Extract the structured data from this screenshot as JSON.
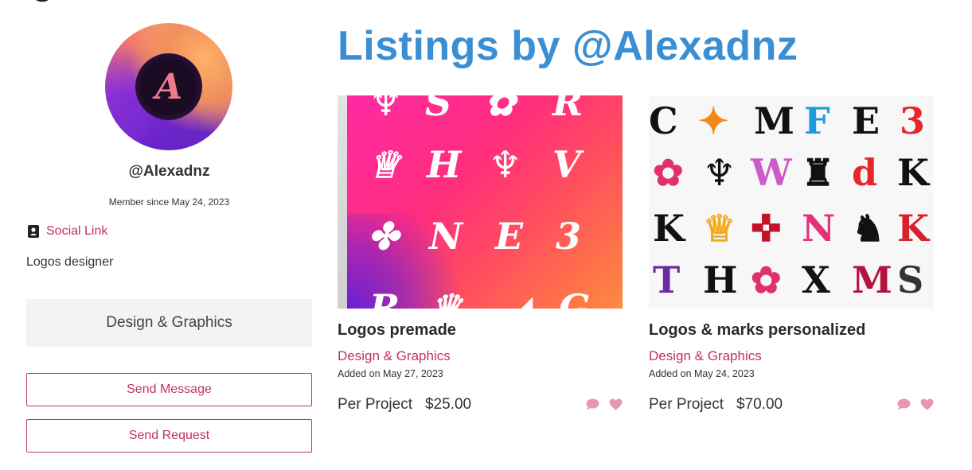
{
  "profile": {
    "username": "@Alexadnz",
    "avatar_letter": "A",
    "member_since": "Member since May 24, 2023",
    "social_link": "Social Link",
    "bio": "Logos designer",
    "category": "Design & Graphics",
    "send_message": "Send Message",
    "send_request": "Send Request"
  },
  "page": {
    "title": "Listings by @Alexadnz"
  },
  "listings": [
    {
      "title": "Logos premade",
      "category": "Design & Graphics",
      "added": "Added on May 27, 2023",
      "price_type": "Per Project",
      "price": "$25.00"
    },
    {
      "title": "Logos & marks personalized",
      "category": "Design & Graphics",
      "added": "Added on May 24, 2023",
      "price_type": "Per Project",
      "price": "$70.00"
    }
  ],
  "colors": {
    "accent": "#c0335f",
    "title_blue": "#3a8fd4",
    "icon_pink": "#e895b4"
  },
  "icons": {
    "message": "chat-bubble-icon",
    "favorite": "heart-icon",
    "social": "contact-card-icon"
  }
}
